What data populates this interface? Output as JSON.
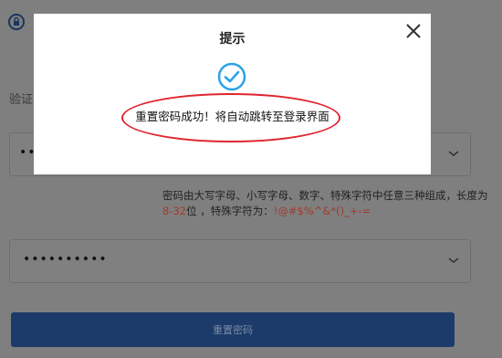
{
  "form": {
    "field_label": "验证",
    "password_masked": "••••••••••",
    "password_masked_short": "••",
    "hint_prefix": "密码由大写字母、小写字母、数字、特殊字符中任意三种组成，长度为 ",
    "hint_length": "8-32",
    "hint_mid": "位 ，特殊字符为：",
    "hint_special": "!@#$%^&*()_+-=",
    "reset_button_label": "重置密码"
  },
  "dialog": {
    "title": "提示",
    "message": "重置密码成功！将自动跳转至登录界面"
  },
  "colors": {
    "overlay": "#7f7f7f",
    "primary_button": "#1c3b6a",
    "check_blue": "#2aa3e6",
    "annotation_red": "#e0262f",
    "hint_red": "#a33a2c"
  },
  "icons": [
    "lock-icon",
    "chevron-down-icon",
    "close-icon",
    "check-circle-icon"
  ]
}
